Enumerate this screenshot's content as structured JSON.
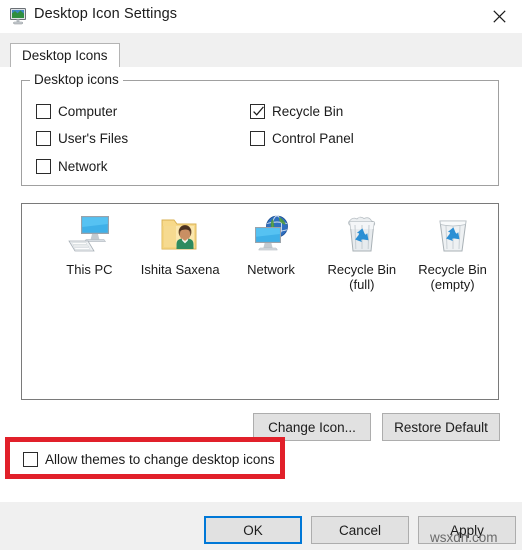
{
  "window": {
    "title": "Desktop Icon Settings",
    "icon": "monitor-display-icon",
    "close_label": "✕"
  },
  "tabs": [
    {
      "label": "Desktop Icons",
      "selected": true
    }
  ],
  "group": {
    "legend": "Desktop icons",
    "checkboxes": [
      {
        "label": "Computer",
        "checked": false,
        "column": "left"
      },
      {
        "label": "User's Files",
        "checked": false,
        "column": "left"
      },
      {
        "label": "Network",
        "checked": false,
        "column": "left"
      },
      {
        "label": "Recycle Bin",
        "checked": true,
        "column": "right"
      },
      {
        "label": "Control Panel",
        "checked": false,
        "column": "right"
      }
    ]
  },
  "preview": {
    "icons": [
      {
        "label": "This PC",
        "icon": "this-pc-icon"
      },
      {
        "label": "Ishita Saxena",
        "icon": "user-files-folder-icon"
      },
      {
        "label": "Network",
        "icon": "network-globe-icon"
      },
      {
        "label": "Recycle Bin\n(full)",
        "icon": "recycle-bin-full-icon"
      },
      {
        "label": "Recycle Bin\n(empty)",
        "icon": "recycle-bin-empty-icon"
      }
    ]
  },
  "actions": {
    "change_icon": "Change Icon...",
    "restore_default": "Restore Default"
  },
  "allow_themes": {
    "label": "Allow themes to change desktop icons",
    "checked": false,
    "highlight_color": "#e1202a"
  },
  "footer": {
    "ok": "OK",
    "cancel": "Cancel",
    "apply": "Apply",
    "default_button": "OK",
    "focus_color": "#0078d7"
  },
  "watermark": "wsxdn.com"
}
